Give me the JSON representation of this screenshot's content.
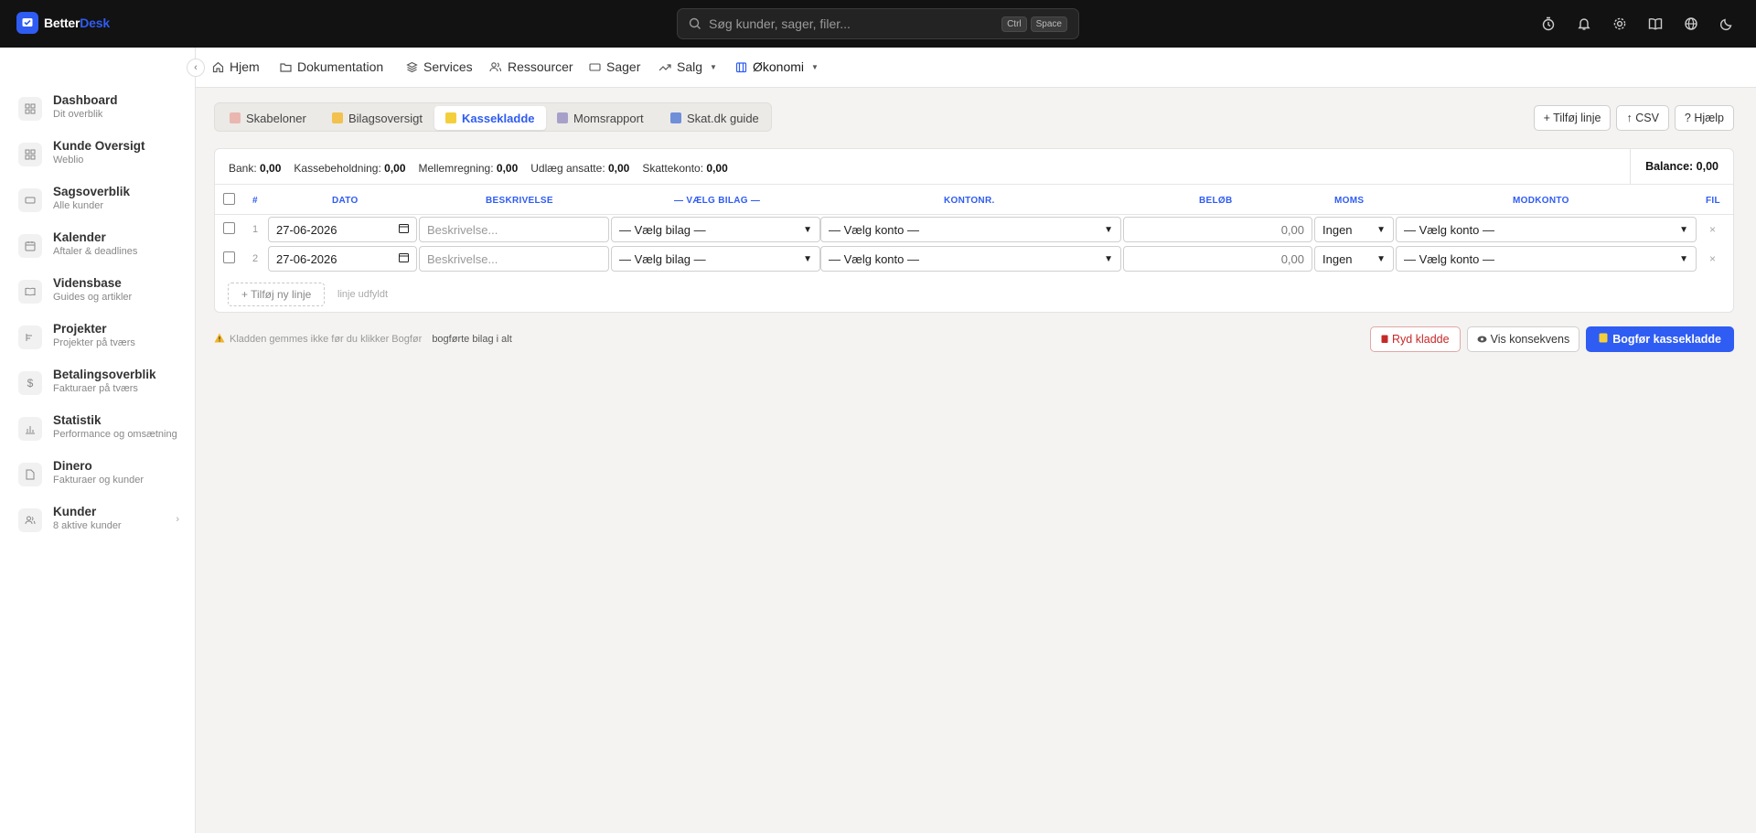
{
  "app": {
    "name_part1": "Better",
    "name_part2": "Desk"
  },
  "search": {
    "placeholder": "Søg kunder, sager, filer...",
    "kbd1": "Ctrl",
    "kbd2": "Space"
  },
  "sidebar": {
    "items": [
      {
        "title": "Dashboard",
        "subtitle": "Dit overblik"
      },
      {
        "title": "Kunde Oversigt",
        "subtitle": "Weblio"
      },
      {
        "title": "Sagsoverblik",
        "subtitle": "Alle kunder"
      },
      {
        "title": "Kalender",
        "subtitle": "Aftaler & deadlines"
      },
      {
        "title": "Vidensbase",
        "subtitle": "Guides og artikler"
      },
      {
        "title": "Projekter",
        "subtitle": "Projekter på tværs"
      },
      {
        "title": "Betalingsoverblik",
        "subtitle": "Fakturaer på tværs"
      },
      {
        "title": "Statistik",
        "subtitle": "Performance og omsætning"
      },
      {
        "title": "Dinero",
        "subtitle": "Fakturaer og kunder"
      },
      {
        "title": "Kunder",
        "subtitle": "8 aktive kunder"
      }
    ]
  },
  "nav": {
    "home": "Hjem",
    "docs": "Dokumentation",
    "services": "Services",
    "resources": "Ressourcer",
    "cases": "Sager",
    "sales": "Salg",
    "economy": "Økonomi"
  },
  "subtabs": {
    "templates": "Skabeloner",
    "vouchers": "Bilagsoversigt",
    "journal": "Kassekladde",
    "vat": "Momsrapport",
    "skat": "Skat.dk guide"
  },
  "actions": {
    "add_line": "+ Tilføj linje",
    "csv": "↑ CSV",
    "help": "? Hjælp"
  },
  "balances": {
    "bank_label": "Bank:",
    "bank_value": "0,00",
    "cash_label": "Kassebeholdning:",
    "cash_value": "0,00",
    "inter_label": "Mellemregning:",
    "inter_value": "0,00",
    "emp_label": "Udlæg ansatte:",
    "emp_value": "0,00",
    "tax_label": "Skattekonto:",
    "tax_value": "0,00",
    "balance": "Balance: 0,00"
  },
  "table": {
    "headers": {
      "num": "#",
      "date": "Dato",
      "desc": "Beskrivelse",
      "voucher": "— Vælg bilag —",
      "account": "Kontonr.",
      "amount": "Beløb",
      "vat": "Moms",
      "counter": "Modkonto",
      "file": "Fil"
    },
    "rows": [
      {
        "num": "1",
        "date": "27-06-2026",
        "desc_placeholder": "Beskrivelse...",
        "voucher": "— Vælg bilag —",
        "account": "— Vælg konto —",
        "amount": "0,00",
        "vat": "Ingen",
        "counter": "— Vælg konto —",
        "remove": "×"
      },
      {
        "num": "2",
        "date": "27-06-2026",
        "desc_placeholder": "Beskrivelse...",
        "voucher": "— Vælg bilag —",
        "account": "— Vælg konto —",
        "amount": "0,00",
        "vat": "Ingen",
        "counter": "— Vælg konto —",
        "remove": "×"
      }
    ],
    "add_new_line": "+ Tilføj ny linje",
    "filled_info": "linje udfyldt"
  },
  "footer": {
    "warning": "Kladden gemmes ikke før du klikker Bogfør",
    "posted": "bogførte bilag i alt",
    "clear": "Ryd kladde",
    "preview": "Vis konsekvens",
    "post": "Bogfør kassekladde"
  },
  "colors": {
    "accent": "#2f5cf2",
    "topbar": "#121212",
    "danger": "#c62828"
  }
}
